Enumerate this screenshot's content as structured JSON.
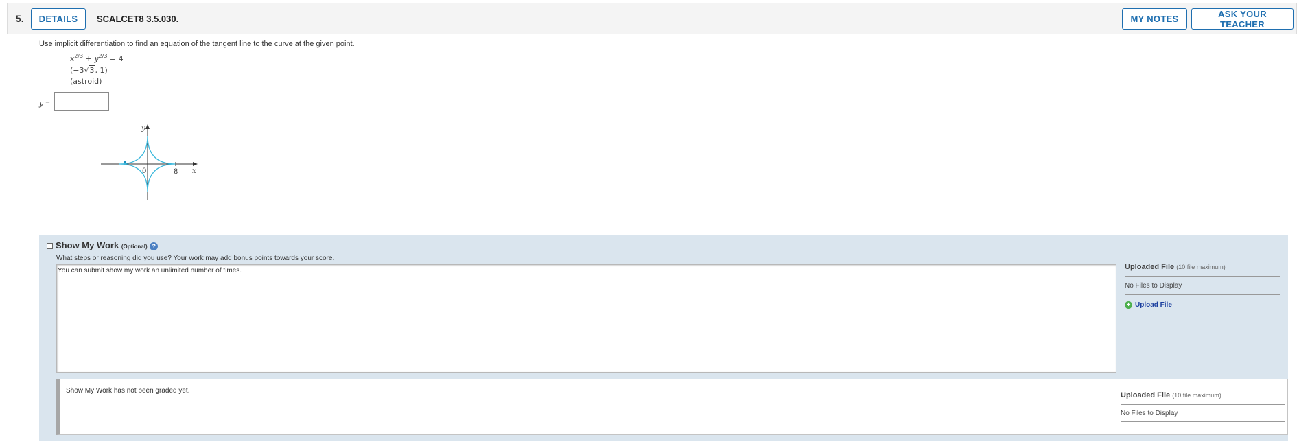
{
  "header": {
    "question_number": "5.",
    "details_label": "DETAILS",
    "question_code": "SCALCET8 3.5.030.",
    "my_notes_label": "MY NOTES",
    "ask_teacher_label": "ASK YOUR TEACHER"
  },
  "problem": {
    "instruction": "Use implicit differentiation to find an equation of the tangent line to the curve at the given point.",
    "equation": "x2/3 + y2/3 = 4",
    "point": "(−3√3, 1)",
    "curve_name": "(astroid)",
    "answer_prefix": "y =",
    "answer_value": ""
  },
  "graph": {
    "y_label": "y",
    "x_label": "x",
    "origin_label": "0",
    "tick_label": "8",
    "curve_color": "#3bb8dc"
  },
  "show_my_work": {
    "title": "Show My Work",
    "optional": "(Optional)",
    "subtitle": "What steps or reasoning did you use? Your work may add bonus points towards your score.",
    "textarea_text": "You can submit show my work an unlimited number of times.",
    "uploaded_title": "Uploaded File",
    "uploaded_max": "(10 file maximum)",
    "no_files": "No Files to Display",
    "upload_link": "Upload File",
    "graded_text": "Show My Work has not been graded yet.",
    "graded_uploaded_title": "Uploaded File",
    "graded_uploaded_max": "(10 file maximum)",
    "graded_no_files": "No Files to Display"
  },
  "colors": {
    "accent": "#1f6fb0",
    "panel_bg": "#dae5ee",
    "link": "#1a3e9e"
  }
}
